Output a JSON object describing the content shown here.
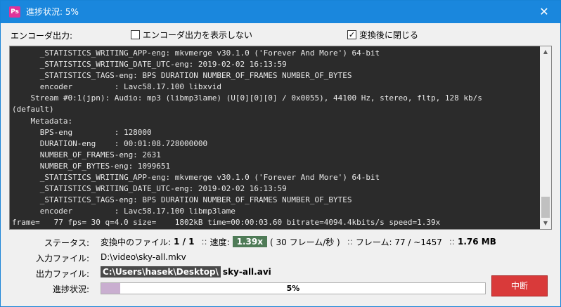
{
  "window": {
    "title": "進捗状況: 5%",
    "app_icon_text": "Ps",
    "close_symbol": "✕"
  },
  "encoder_bar": {
    "label": "エンコーダ出力:",
    "show_output_checkbox": {
      "label": "エンコーダ出力を表示しない",
      "checked": false
    },
    "close_after_checkbox": {
      "label": "変換後に閉じる",
      "checked": true,
      "check_mark": "✓"
    }
  },
  "console": {
    "lines": [
      "      _STATISTICS_WRITING_APP-eng: mkvmerge v30.1.0 ('Forever And More') 64-bit",
      "      _STATISTICS_WRITING_DATE_UTC-eng: 2019-02-02 16:13:59",
      "      _STATISTICS_TAGS-eng: BPS DURATION NUMBER_OF_FRAMES NUMBER_OF_BYTES",
      "      encoder         : Lavc58.17.100 libxvid",
      "    Stream #0:1(jpn): Audio: mp3 (libmp3lame) (U[0][0][0] / 0x0055), 44100 Hz, stereo, fltp, 128 kb/s",
      "(default)",
      "    Metadata:",
      "      BPS-eng         : 128000",
      "      DURATION-eng    : 00:01:08.728000000",
      "      NUMBER_OF_FRAMES-eng: 2631",
      "      NUMBER_OF_BYTES-eng: 1099651",
      "      _STATISTICS_WRITING_APP-eng: mkvmerge v30.1.0 ('Forever And More') 64-bit",
      "      _STATISTICS_WRITING_DATE_UTC-eng: 2019-02-02 16:13:59",
      "      _STATISTICS_TAGS-eng: BPS DURATION NUMBER_OF_FRAMES NUMBER_OF_BYTES",
      "      encoder         : Lavc58.17.100 libmp3lame",
      "frame=   77 fps= 30 q=4.0 size=    1802kB time=00:00:03.60 bitrate=4094.4kbits/s speed=1.39x"
    ],
    "scroll_up": "▲",
    "scroll_down": "▼"
  },
  "status": {
    "label": "ステータス:",
    "file_label": "変換中のファイル:",
    "file_value": "1 / 1",
    "separator": "::",
    "speed_label": "速度:",
    "speed_value": "1.39x",
    "fps_text": "( 30 フレーム/秒 )",
    "frames_text": "フレーム: 77 / ~1457",
    "size_value": "1.76 MB"
  },
  "input": {
    "label": "入力ファイル:",
    "value": "D:\\video\\sky-all.mkv"
  },
  "output": {
    "label": "出力ファイル:",
    "path": "C:\\Users\\hasek\\Desktop\\",
    "file": "sky-all.avi"
  },
  "progress": {
    "label": "進捗状況:",
    "text": "5%",
    "fraction": 0.05
  },
  "stop_button": {
    "label": "中断"
  },
  "colors": {
    "titlebar": "#1a87dd",
    "console_bg": "#2b2b2b",
    "speed_badge": "#4f7b57",
    "progress_fill": "#c9aed0",
    "stop_button": "#d93a3a"
  }
}
